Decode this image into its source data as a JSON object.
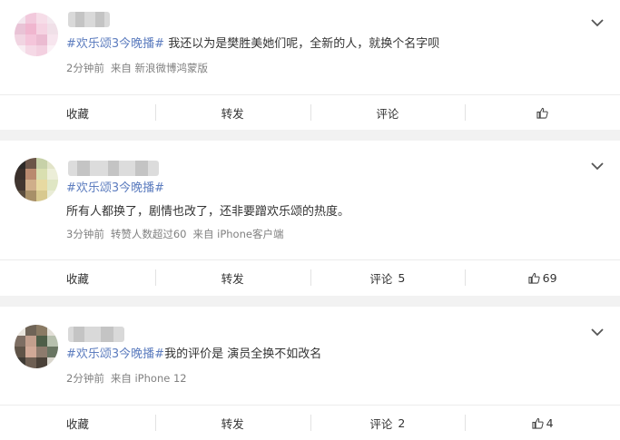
{
  "comments": [
    {
      "topic": "#欢乐颂3今晚播#",
      "text": " 我还以为是樊胜美她们呢，全新的人，就换个名字呗",
      "meta": [
        "2分钟前",
        "来自 新浪微博鸿蒙版"
      ],
      "actions": {
        "collect": "收藏",
        "repost": "转发",
        "comment": "评论",
        "comment_count": "",
        "like_count": ""
      }
    },
    {
      "topic": "#欢乐颂3今晚播#",
      "text": "所有人都换了，剧情也改了，还非要蹭欢乐颂的热度。",
      "meta": [
        "3分钟前",
        "转赞人数超过60",
        "来自 iPhone客户端"
      ],
      "actions": {
        "collect": "收藏",
        "repost": "转发",
        "comment": "评论",
        "comment_count": "5",
        "like_count": "69"
      }
    },
    {
      "topic": "#欢乐颂3今晚播#",
      "text": "我的评价是 演员全换不如改名",
      "meta": [
        "2分钟前",
        "来自 iPhone 12"
      ],
      "actions": {
        "collect": "收藏",
        "repost": "转发",
        "comment": "评论",
        "comment_count": "2",
        "like_count": "4"
      }
    }
  ],
  "icons": {
    "more": "chevron-down-icon",
    "like": "thumbs-up-icon"
  },
  "colors": {
    "topic": "#5d7dbf",
    "meta": "#808080",
    "background": "#f2f2f2"
  }
}
